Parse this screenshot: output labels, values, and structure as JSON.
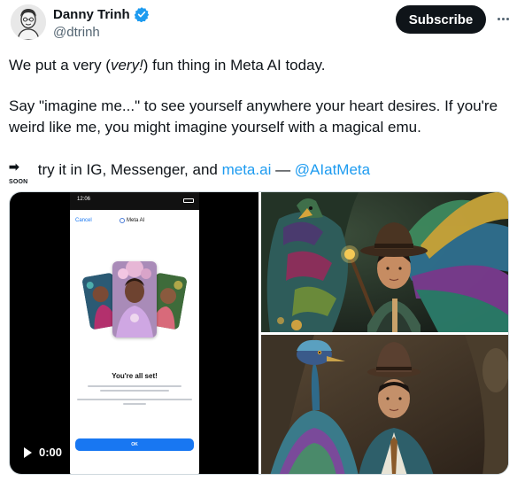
{
  "author": {
    "name": "Danny Trinh",
    "handle": "@dtrinh",
    "verified_icon": "verified-badge-icon",
    "verified_color": "#1d9bf0"
  },
  "actions": {
    "subscribe_label": "Subscribe",
    "more_icon": "more-icon"
  },
  "tweet": {
    "line1_pre": "We put a very (",
    "line1_em": "very!",
    "line1_post": ") fun thing in Meta AI today.",
    "line2": "Say \"imagine me...\" to see yourself anywhere your heart desires. If you're weird like me, you might imagine yourself with a magical emu.",
    "line3_emoji": "soon-arrow-emoji",
    "soon_arrow": "➡",
    "soon_text": "SOON",
    "line3_pre": " try it in IG, Messenger, and ",
    "link1": "meta.ai",
    "line3_mid": " — ",
    "link2": "@AIatMeta",
    "link_color": "#1d9bf0"
  },
  "video": {
    "time": "0:00",
    "play_icon": "play-icon",
    "phone": {
      "status_time": "12:06",
      "cancel": "Cancel",
      "title": "Meta AI",
      "heading": "You're all set!",
      "ok_label": "OK"
    }
  },
  "images": {
    "top": "man-with-peacock-bird-image",
    "bottom": "man-with-emu-image"
  }
}
